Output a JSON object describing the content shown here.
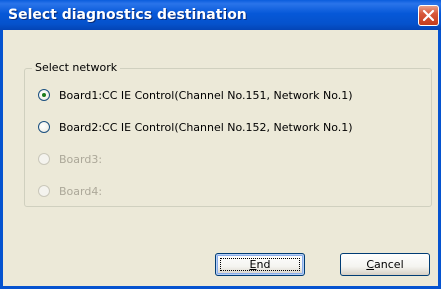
{
  "window": {
    "title": "Select diagnostics destination"
  },
  "group": {
    "title": "Select network",
    "options": [
      {
        "label": "Board1:CC IE Control(Channel No.151, Network No.1)",
        "selected": true,
        "enabled": true
      },
      {
        "label": "Board2:CC IE Control(Channel No.152, Network No.1)",
        "selected": false,
        "enabled": true
      },
      {
        "label": "Board3:",
        "selected": false,
        "enabled": false
      },
      {
        "label": "Board4:",
        "selected": false,
        "enabled": false
      }
    ]
  },
  "buttons": {
    "end": {
      "mnemonic": "E",
      "rest": "nd"
    },
    "cancel": {
      "mnemonic": "C",
      "rest": "ancel"
    }
  },
  "icons": {
    "close": "close-icon"
  },
  "colors": {
    "titlebar": "#0553d0",
    "dialog_bg": "#ece9d8",
    "close_button": "#d8583a",
    "disabled_text": "#aca899",
    "radio_dot": "#1b7b1b"
  }
}
